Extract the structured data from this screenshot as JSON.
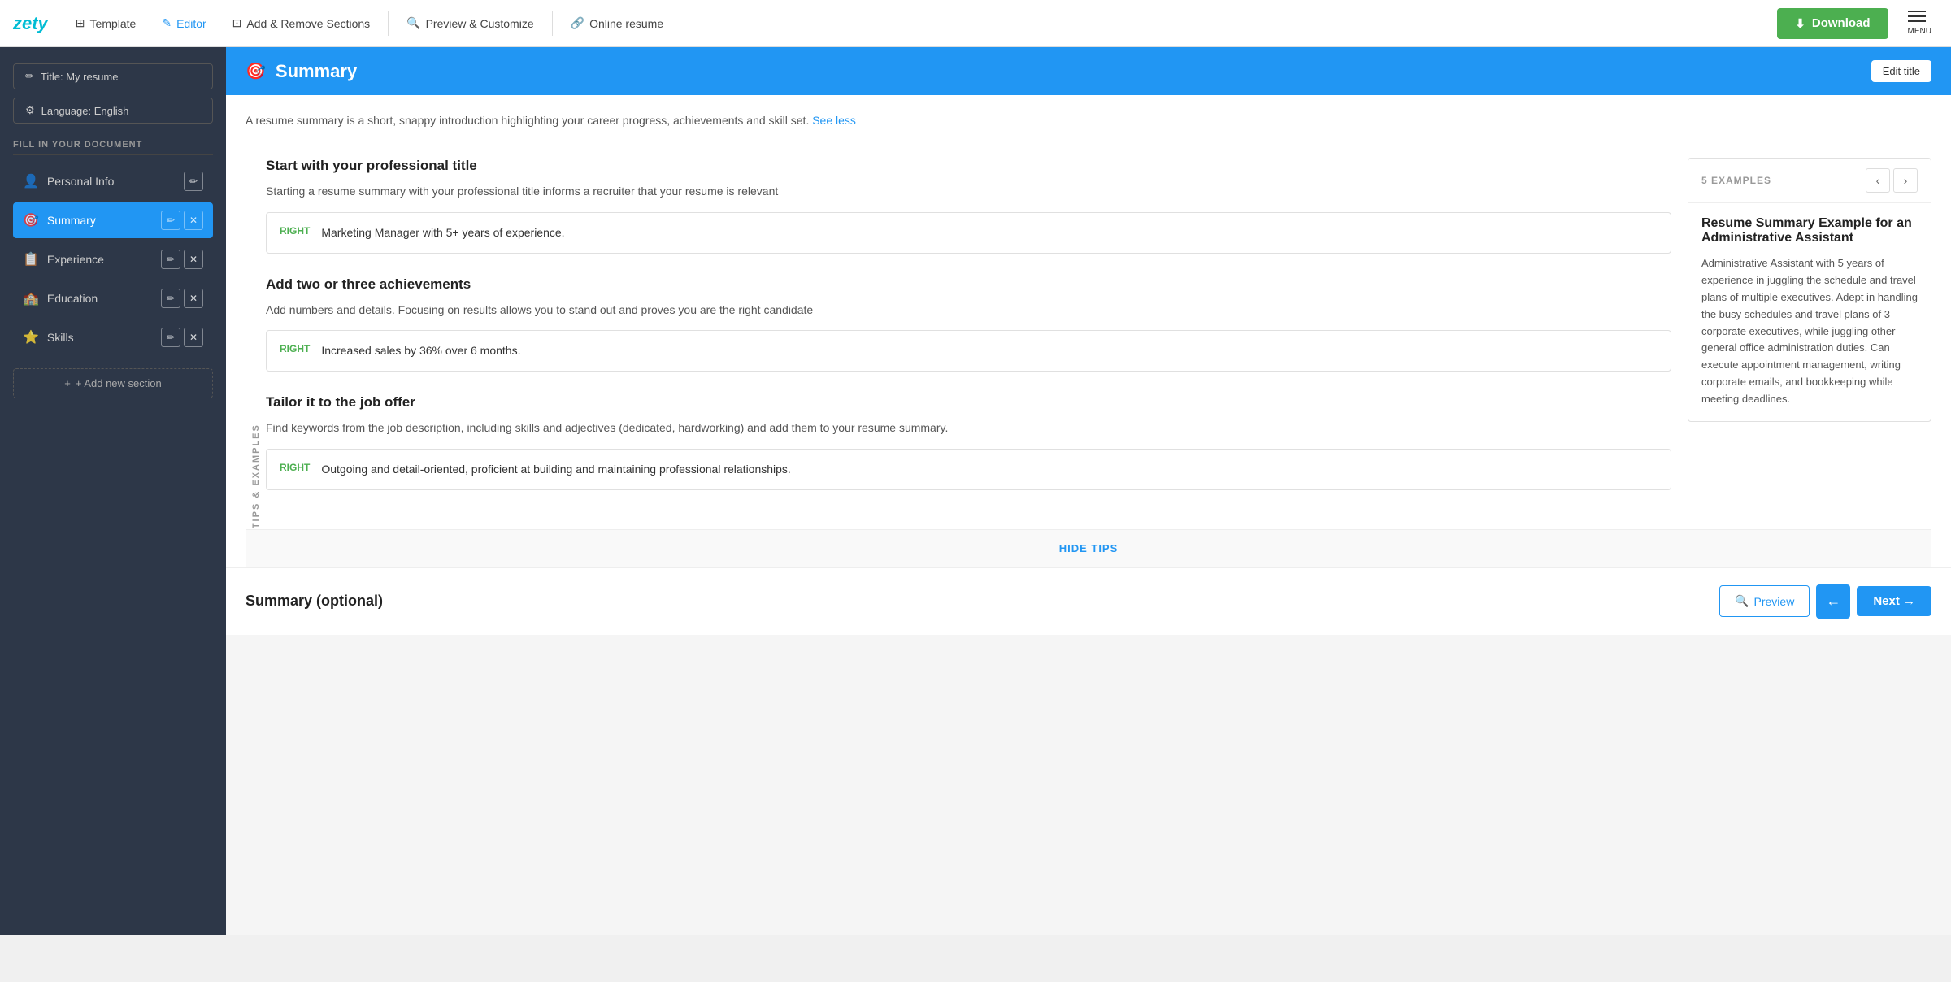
{
  "brand": {
    "logo": "zety"
  },
  "topnav": {
    "items": [
      {
        "id": "template",
        "label": "Template",
        "icon": "⊞",
        "active": false
      },
      {
        "id": "editor",
        "label": "Editor",
        "icon": "✎",
        "active": true
      },
      {
        "id": "add-remove",
        "label": "Add & Remove Sections",
        "icon": "⊡",
        "active": false
      },
      {
        "id": "preview-customize",
        "label": "Preview & Customize",
        "icon": "🔍",
        "active": false
      },
      {
        "id": "online-resume",
        "label": "Online resume",
        "icon": "🔗",
        "active": false
      }
    ],
    "download_label": "Download",
    "menu_label": "MENU"
  },
  "sidebar": {
    "title_btn_label": "Title: My resume",
    "language_btn_label": "Language: English",
    "fill_label": "FILL IN YOUR DOCUMENT",
    "items": [
      {
        "id": "personal-info",
        "label": "Personal Info",
        "icon": "👤",
        "active": false
      },
      {
        "id": "summary",
        "label": "Summary",
        "icon": "🎯",
        "active": true
      },
      {
        "id": "experience",
        "label": "Experience",
        "icon": "📋",
        "active": false
      },
      {
        "id": "education",
        "label": "Education",
        "icon": "🏫",
        "active": false
      },
      {
        "id": "skills",
        "label": "Skills",
        "icon": "⭐",
        "active": false
      }
    ],
    "add_section_label": "+ Add new section"
  },
  "section": {
    "title": "Summary",
    "edit_title_label": "Edit title",
    "intro_text": "A resume summary is a short, snappy introduction highlighting your career progress, achievements and skill set.",
    "see_less_label": "See less",
    "tips_label": "TIPS & EXAMPLES",
    "tips": [
      {
        "id": "tip1",
        "heading": "Start with your professional title",
        "description": "Starting a resume summary with your professional title informs a recruiter that your resume is relevant",
        "badge": "RIGHT",
        "example": "Marketing Manager with 5+ years of experience."
      },
      {
        "id": "tip2",
        "heading": "Add two or three achievements",
        "description": "Add numbers and details. Focusing on results allows you to stand out and proves you are the right candidate",
        "badge": "RIGHT",
        "example": "Increased sales by 36% over 6 months."
      },
      {
        "id": "tip3",
        "heading": "Tailor it to the job offer",
        "description": "Find keywords from the job description, including skills and adjectives (dedicated, hardworking) and add them to your resume summary.",
        "badge": "RIGHT",
        "example": "Outgoing and detail-oriented, proficient at building and maintaining professional relationships."
      }
    ],
    "examples_panel": {
      "count_label": "5 EXAMPLES",
      "example_title": "Resume Summary Example for an Administrative Assistant",
      "example_text": "Administrative Assistant with 5 years of experience in juggling the schedule and travel plans of multiple executives. Adept in handling the busy schedules and travel plans of 3 corporate executives, while juggling other general office administration duties. Can execute appointment management, writing corporate emails, and bookkeeping while meeting deadlines."
    },
    "hide_tips_label": "HIDE TIPS",
    "bottom": {
      "optional_title": "Summary (optional)",
      "preview_label": "Preview",
      "next_label": "Next →",
      "back_label": "←"
    }
  }
}
